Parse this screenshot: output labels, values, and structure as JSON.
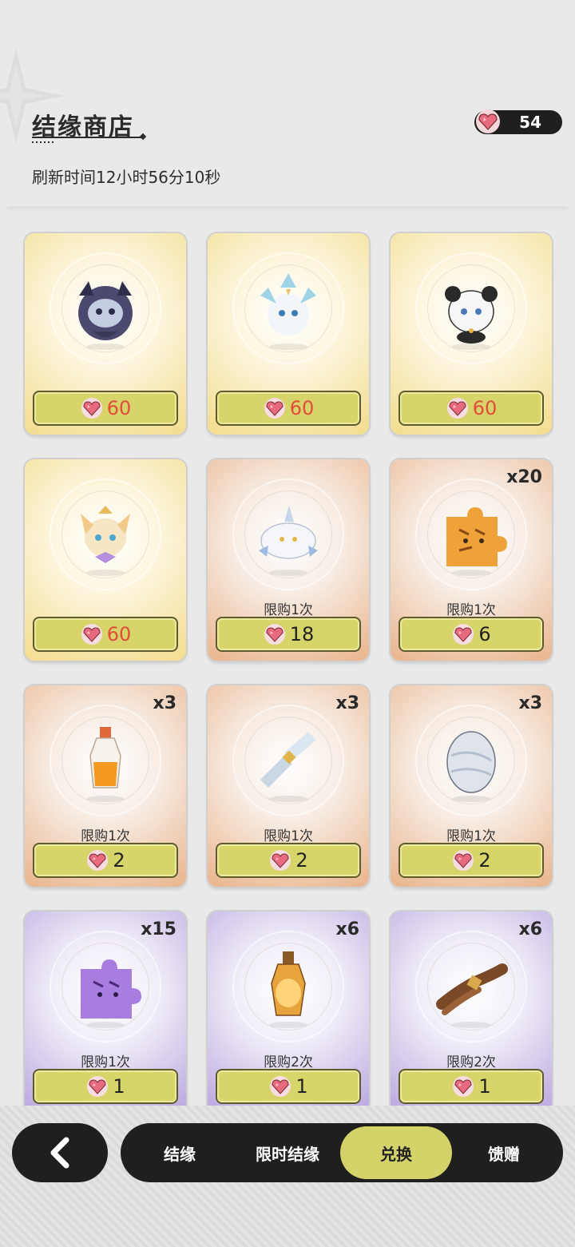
{
  "header": {
    "title": "结缘商店",
    "refresh_text": "刷新时间12小时56分10秒",
    "currency_amount": "54",
    "currency_icon": "heart-gem-icon"
  },
  "colors": {
    "button_fill": "#d7d46a",
    "price_red": "#e24c3d",
    "nav_bg": "#1f1f1f",
    "nav_active": "#d4d36a"
  },
  "items": [
    {
      "icon": "dark-mask-spirit-icon",
      "tier": "gold",
      "qty": "",
      "limit": "",
      "price": "60",
      "price_red": true
    },
    {
      "icon": "ice-kirin-spirit-icon",
      "tier": "gold",
      "qty": "",
      "limit": "",
      "price": "60",
      "price_red": true
    },
    {
      "icon": "panda-spirit-icon",
      "tier": "gold",
      "qty": "",
      "limit": "",
      "price": "60",
      "price_red": true
    },
    {
      "icon": "fox-spirit-icon",
      "tier": "gold",
      "qty": "",
      "limit": "",
      "price": "60",
      "price_red": true
    },
    {
      "icon": "unicorn-ghost-spirit-icon",
      "tier": "orange",
      "qty": "",
      "limit": "限购1次",
      "price": "18",
      "price_red": false
    },
    {
      "icon": "tiger-puzzle-piece-icon",
      "tier": "orange",
      "qty": "x20",
      "limit": "限购1次",
      "price": "6",
      "price_red": false
    },
    {
      "icon": "orange-potion-bottle-icon",
      "tier": "orange",
      "qty": "x3",
      "limit": "限购1次",
      "price": "2",
      "price_red": false
    },
    {
      "icon": "silver-ribbon-bundle-icon",
      "tier": "orange",
      "qty": "x3",
      "limit": "限购1次",
      "price": "2",
      "price_red": false
    },
    {
      "icon": "silver-egg-icon",
      "tier": "orange",
      "qty": "x3",
      "limit": "限购1次",
      "price": "2",
      "price_red": false
    },
    {
      "icon": "purple-cat-puzzle-piece-icon",
      "tier": "purple",
      "qty": "x15",
      "limit": "限购1次",
      "price": "1",
      "price_red": false
    },
    {
      "icon": "amber-potion-bottle-icon",
      "tier": "purple",
      "qty": "x6",
      "limit": "限购2次",
      "price": "1",
      "price_red": false
    },
    {
      "icon": "brown-rope-bundle-icon",
      "tier": "purple",
      "qty": "x6",
      "limit": "限购2次",
      "price": "1",
      "price_red": false
    }
  ],
  "nav": {
    "back_icon": "chevron-left-icon",
    "tabs": [
      {
        "label": "结缘",
        "active": false
      },
      {
        "label": "限时结缘",
        "active": false
      },
      {
        "label": "兑换",
        "active": true
      },
      {
        "label": "馈赠",
        "active": false
      }
    ]
  }
}
